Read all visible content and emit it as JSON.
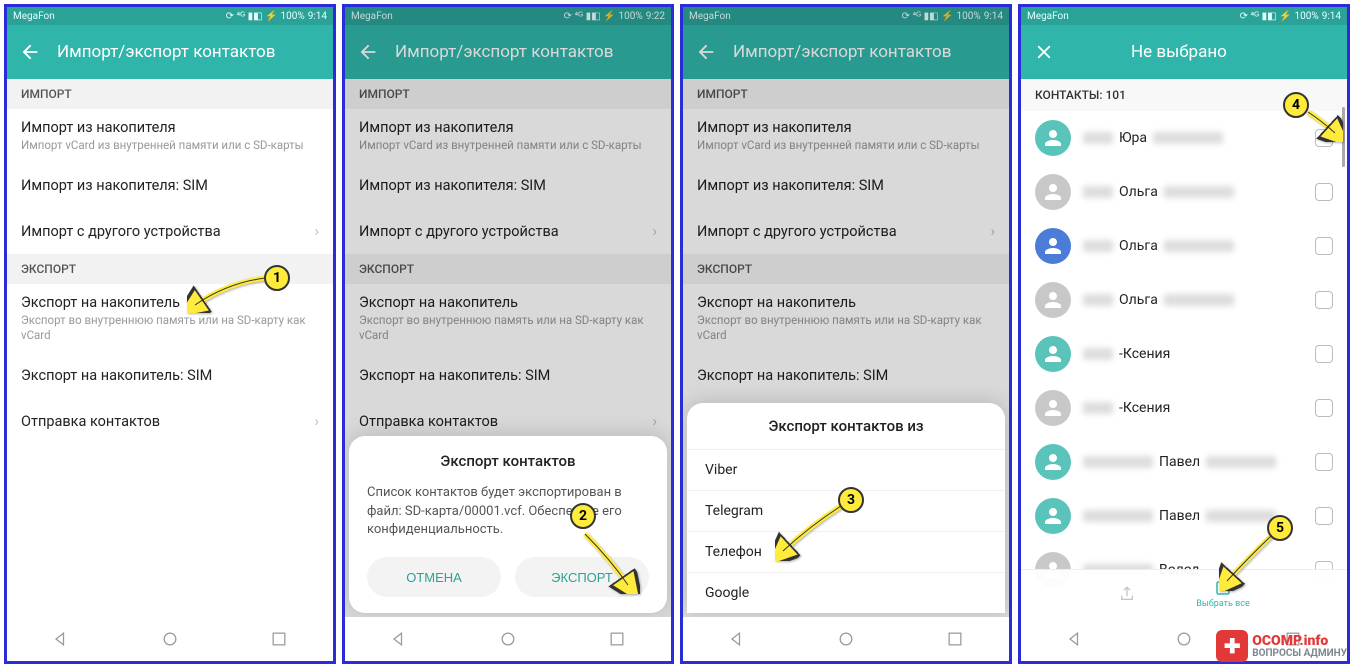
{
  "statusbar": {
    "carrier": "MegaFon",
    "battery": "100%",
    "times": [
      "9:14",
      "9:22",
      "9:14",
      "9:14"
    ],
    "icons": "⟳ ⁴ᴳ ▮◧ ⚡"
  },
  "appbar": {
    "title": "Импорт/экспорт контактов",
    "title4": "Не выбрано"
  },
  "sections": {
    "import": "ИМПОРТ",
    "export": "ЭКСПОРТ"
  },
  "items": {
    "imp_storage": {
      "t": "Импорт из накопителя",
      "s": "Импорт vCard из внутренней памяти или с SD-карты"
    },
    "imp_sim": "Импорт из накопителя: SIM",
    "imp_device": "Импорт с другого устройства",
    "exp_storage": {
      "t": "Экспорт на накопитель",
      "s": "Экспорт во внутреннюю память или на SD-карту как vCard"
    },
    "exp_sim": "Экспорт на накопитель: SIM",
    "send": "Отправка контактов"
  },
  "dialog": {
    "title": "Экспорт контактов",
    "text": "Список контактов будет экспортирован в файл: SD-карта/00001.vcf. Обеспечьте его конфиденциальность.",
    "cancel": "ОТМЕНА",
    "ok": "ЭКСПОРТ"
  },
  "sheet": {
    "title": "Экспорт контактов из",
    "opts": [
      "Viber",
      "Telegram",
      "Телефон",
      "Google"
    ]
  },
  "contacts": {
    "header": "КОНТАКТЫ: 101",
    "names": [
      "Юра",
      "Ольга",
      "Ольга",
      "Ольга",
      "-Ксения",
      "-Ксения",
      "Павел",
      "Павел",
      "Волод"
    ]
  },
  "bottombar": {
    "selectall": "Выбрать все"
  },
  "badges": [
    "1",
    "2",
    "3",
    "4",
    "5"
  ]
}
